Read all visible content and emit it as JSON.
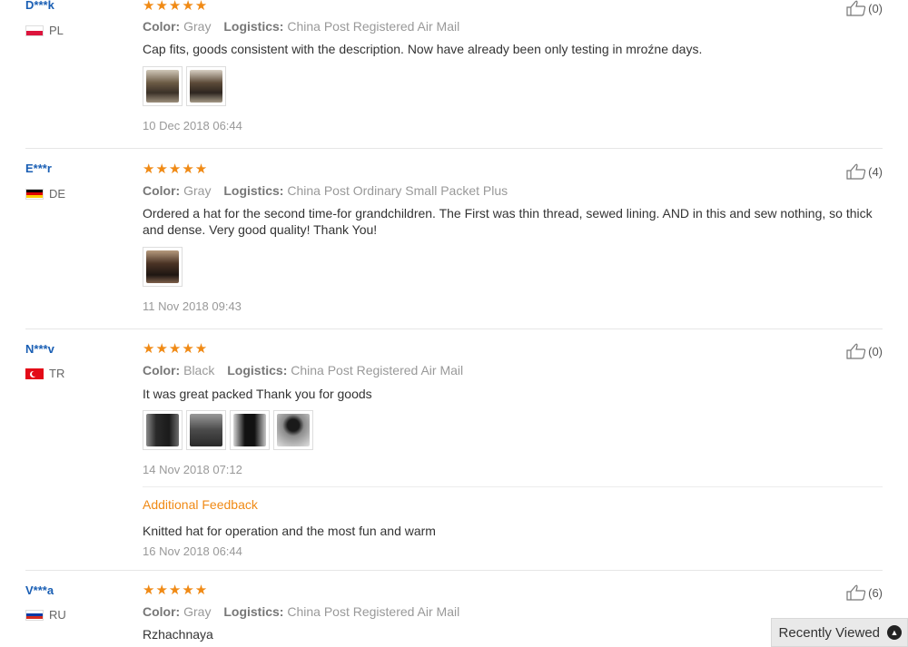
{
  "reviews": [
    {
      "user": "D***k",
      "country": "PL",
      "stars": "★★★★★",
      "color_label": "Color:",
      "color": "Gray",
      "logistics_label": "Logistics:",
      "logistics": "China Post Registered Air Mail",
      "text": "Cap fits, goods consistent with the description. Now have already been only testing in mroźne days.",
      "date": "10 Dec 2018 06:44",
      "likes": "(0)"
    },
    {
      "user": "E***r",
      "country": "DE",
      "stars": "★★★★★",
      "color_label": "Color:",
      "color": "Gray",
      "logistics_label": "Logistics:",
      "logistics": "China Post Ordinary Small Packet Plus",
      "text": "Ordered a hat for the second time-for grandchildren. The First was thin thread, sewed lining. AND in this and sew nothing, so thick and dense. Very good quality! Thank You!",
      "date": "11 Nov 2018 09:43",
      "likes": "(4)"
    },
    {
      "user": "N***v",
      "country": "TR",
      "stars": "★★★★★",
      "color_label": "Color:",
      "color": "Black",
      "logistics_label": "Logistics:",
      "logistics": "China Post Registered Air Mail",
      "text": "It was great packed Thank you for goods",
      "date": "14 Nov 2018 07:12",
      "likes": "(0)",
      "additional_label": "Additional Feedback",
      "additional_text": "Knitted hat for operation and the most fun and warm",
      "additional_date": "16 Nov 2018 06:44"
    },
    {
      "user": "V***a",
      "country": "RU",
      "stars": "★★★★★",
      "color_label": "Color:",
      "color": "Gray",
      "logistics_label": "Logistics:",
      "logistics": "China Post Registered Air Mail",
      "text": "Rzhachnaya",
      "likes": "(6)"
    }
  ],
  "recently_viewed": {
    "label": "Recently Viewed",
    "icon": "chevron-up-circle-icon"
  },
  "colors": {
    "star": "#f08a15",
    "username": "#1a5fb4",
    "feedback_accent": "#f08a15"
  }
}
